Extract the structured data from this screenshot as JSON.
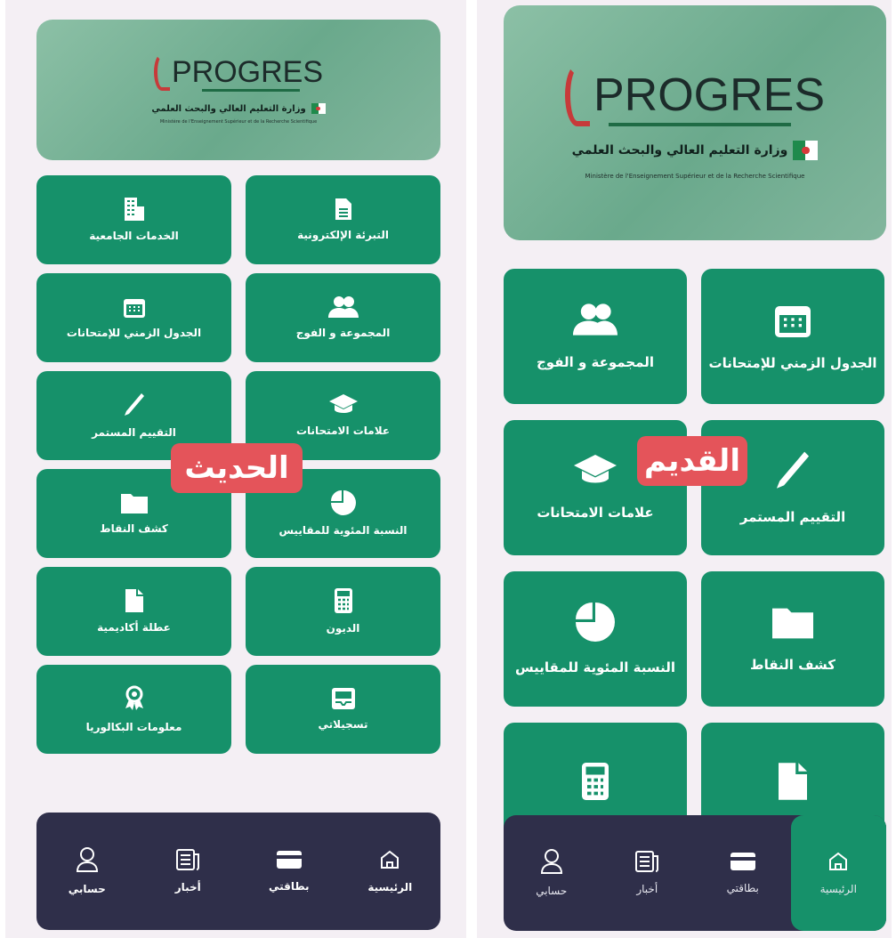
{
  "colors": {
    "tile": "#16916a",
    "navbar": "#2f2f4a",
    "badge": "#e4545a",
    "banner": "#7fb59b"
  },
  "logo": {
    "brand": "PROGRES",
    "ministry_ar": "وزارة التعليم العالي والبحث العلمي",
    "ministry_fr": "Ministère de l'Enseignement Supérieur et de la Recherche Scientifique"
  },
  "new_app": {
    "badge": "الحديث",
    "tiles": [
      {
        "label": "التبرئة الإلكترونية",
        "icon": "document-icon"
      },
      {
        "label": "الخدمات الجامعية",
        "icon": "building-icon"
      },
      {
        "label": "المجموعة و الفوج",
        "icon": "group-icon"
      },
      {
        "label": "الجدول الزمني للإمتحانات",
        "icon": "calendar-icon"
      },
      {
        "label": "علامات الامتحانات",
        "icon": "graduation-cap-icon"
      },
      {
        "label": "التقييم المستمر",
        "icon": "pencil-icon"
      },
      {
        "label": "النسبة المئوية للمقاييس",
        "icon": "pie-chart-icon"
      },
      {
        "label": "كشف النقاط",
        "icon": "folder-icon"
      },
      {
        "label": "الديون",
        "icon": "calculator-icon"
      },
      {
        "label": "عطلة أكاديمية",
        "icon": "file-icon"
      },
      {
        "label": "تسجيلاتي",
        "icon": "inbox-icon"
      },
      {
        "label": "معلومات البكالوريا",
        "icon": "award-icon"
      }
    ],
    "nav": [
      {
        "label": "الرئيسية",
        "icon": "home-icon"
      },
      {
        "label": "بطاقتي",
        "icon": "card-icon"
      },
      {
        "label": "أخبار",
        "icon": "news-icon"
      },
      {
        "label": "حسابي",
        "icon": "user-icon"
      }
    ]
  },
  "old_app": {
    "badge": "القديم",
    "tiles": [
      {
        "label": "الجدول الزمني للإمتحانات",
        "icon": "calendar-icon"
      },
      {
        "label": "المجموعة و الفوج",
        "icon": "group-icon"
      },
      {
        "label": "التقييم المستمر",
        "icon": "pencil-icon"
      },
      {
        "label": "علامات الامتحانات",
        "icon": "graduation-cap-icon"
      },
      {
        "label": "كشف النقاط",
        "icon": "folder-icon"
      },
      {
        "label": "النسبة المئوية للمقاييس",
        "icon": "pie-chart-icon"
      },
      {
        "label": "",
        "icon": "file-icon"
      },
      {
        "label": "",
        "icon": "calculator-icon"
      }
    ],
    "nav": [
      {
        "label": "الرئيسية",
        "icon": "home-icon",
        "active": true
      },
      {
        "label": "بطاقتي",
        "icon": "card-icon"
      },
      {
        "label": "أخبار",
        "icon": "news-icon"
      },
      {
        "label": "حسابي",
        "icon": "user-icon"
      }
    ]
  }
}
